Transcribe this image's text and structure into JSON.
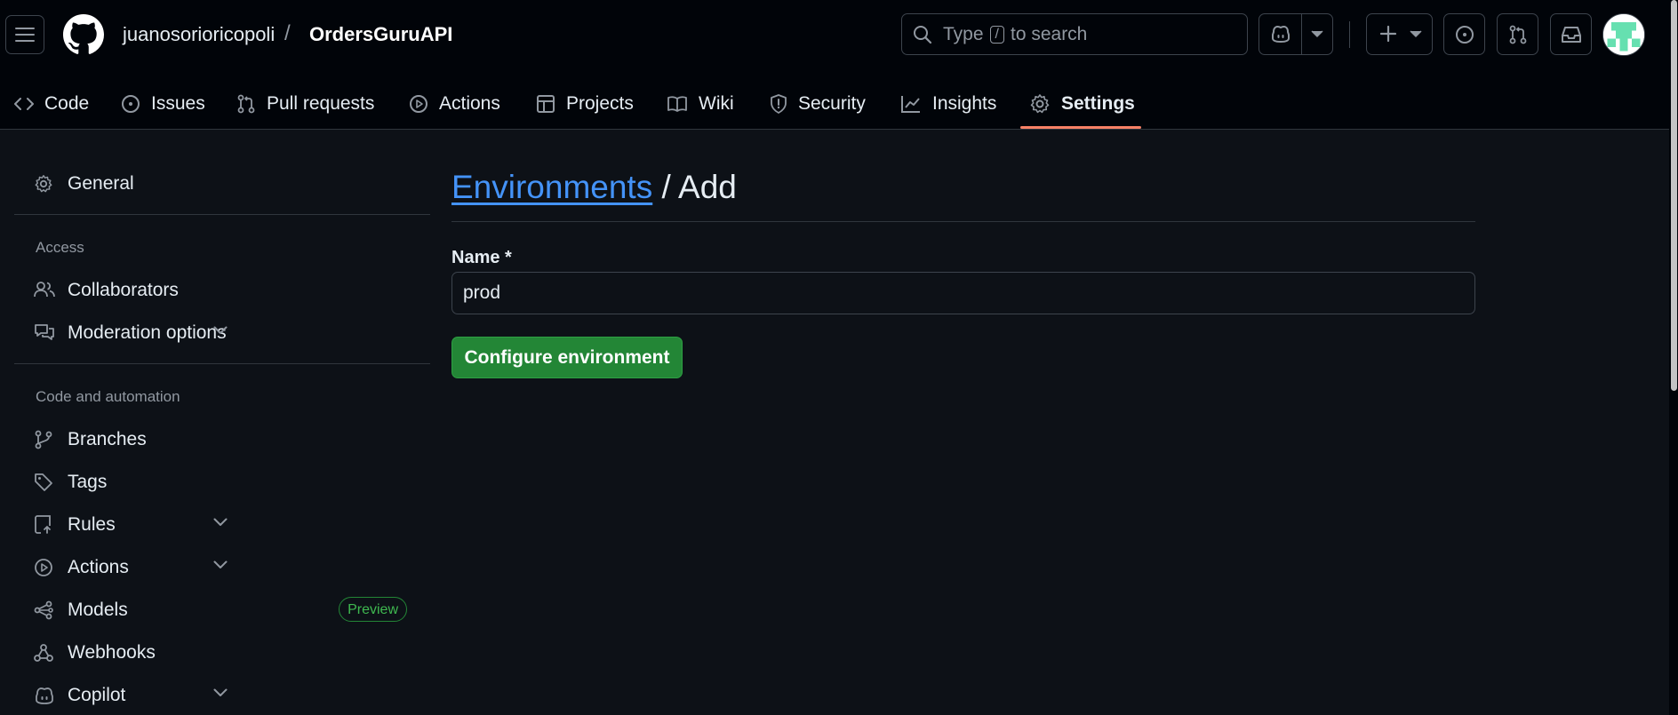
{
  "header": {
    "owner": "juanosorioricopoli",
    "separator": "/",
    "repo": "OrdersGuruAPI",
    "search": {
      "prefix": "Type",
      "key": "/",
      "suffix": "to search"
    }
  },
  "tabs": [
    {
      "label": "Code",
      "icon": "code-icon"
    },
    {
      "label": "Issues",
      "icon": "issue-opened-icon"
    },
    {
      "label": "Pull requests",
      "icon": "git-pull-request-icon"
    },
    {
      "label": "Actions",
      "icon": "play-icon"
    },
    {
      "label": "Projects",
      "icon": "table-icon"
    },
    {
      "label": "Wiki",
      "icon": "book-icon"
    },
    {
      "label": "Security",
      "icon": "shield-icon"
    },
    {
      "label": "Insights",
      "icon": "graph-icon"
    },
    {
      "label": "Settings",
      "icon": "gear-icon",
      "selected": true
    }
  ],
  "sidebar": {
    "general": "General",
    "access_heading": "Access",
    "collaborators": "Collaborators",
    "moderation": "Moderation options",
    "code_heading": "Code and automation",
    "branches": "Branches",
    "tags": "Tags",
    "rules": "Rules",
    "actions": "Actions",
    "models": "Models",
    "models_badge": "Preview",
    "webhooks": "Webhooks",
    "copilot": "Copilot"
  },
  "main": {
    "breadcrumb_link": "Environments",
    "breadcrumb_rest": " / Add",
    "name_label": "Name *",
    "name_value": "prod",
    "submit_label": "Configure environment"
  },
  "colors": {
    "background": "#0d1117",
    "header_bg": "#010409",
    "accent_underline": "#f78166",
    "link": "#4493f8",
    "primary_button": "#238636"
  }
}
